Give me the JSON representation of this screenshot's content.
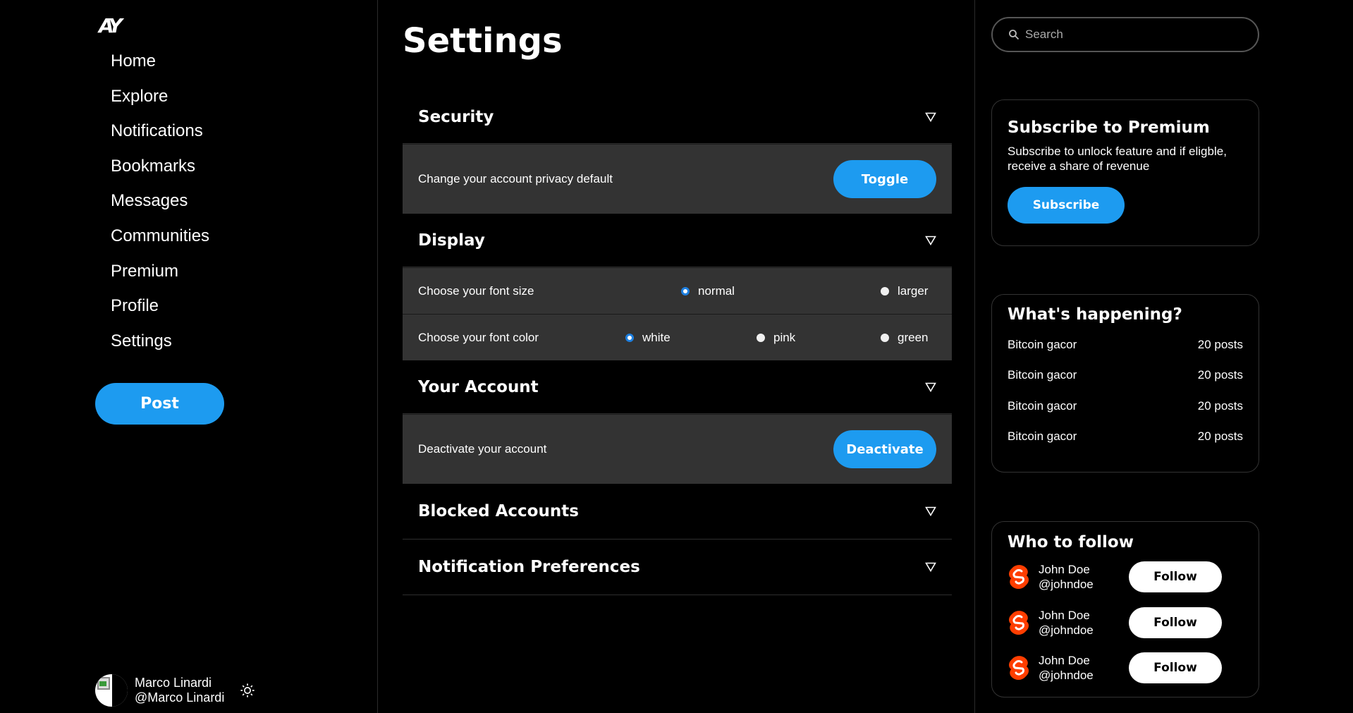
{
  "sidebar": {
    "logo": "AY",
    "nav": [
      "Home",
      "Explore",
      "Notifications",
      "Bookmarks",
      "Messages",
      "Communities",
      "Premium",
      "Profile",
      "Settings"
    ],
    "post_label": "Post",
    "user": {
      "name": "Marco Linardi",
      "handle": "@Marco Linardi"
    }
  },
  "main": {
    "title": "Settings",
    "security": {
      "title": "Security",
      "privacy_label": "Change your account privacy default",
      "toggle_label": "Toggle"
    },
    "display": {
      "title": "Display",
      "font_size_label": "Choose your font size",
      "font_size_options": [
        "normal",
        "larger"
      ],
      "font_size_selected": "normal",
      "font_color_label": "Choose your font color",
      "font_color_options": [
        "white",
        "pink",
        "green"
      ],
      "font_color_selected": "white"
    },
    "account": {
      "title": "Your Account",
      "deactivate_label": "Deactivate your account",
      "deactivate_button": "Deactivate"
    },
    "blocked": {
      "title": "Blocked Accounts"
    },
    "notifications": {
      "title": "Notification Preferences"
    }
  },
  "right": {
    "search": {
      "placeholder": "Search"
    },
    "premium": {
      "title": "Subscribe to Premium",
      "text": "Subscribe to unlock feature and if eligble, receive a share of revenue",
      "button": "Subscribe"
    },
    "trends": {
      "title": "What's happening?",
      "items": [
        {
          "topic": "Bitcoin gacor",
          "count": "20 posts"
        },
        {
          "topic": "Bitcoin gacor",
          "count": "20 posts"
        },
        {
          "topic": "Bitcoin gacor",
          "count": "20 posts"
        },
        {
          "topic": "Bitcoin gacor",
          "count": "20 posts"
        }
      ]
    },
    "follow": {
      "title": "Who to follow",
      "button": "Follow",
      "people": [
        {
          "name": "John Doe",
          "handle": "@johndoe"
        },
        {
          "name": "John Doe",
          "handle": "@johndoe"
        },
        {
          "name": "John Doe",
          "handle": "@johndoe"
        }
      ]
    }
  },
  "colors": {
    "accent": "#1d9bf0",
    "background": "#000000",
    "row": "#333333",
    "svelte": "#ff3e00"
  }
}
